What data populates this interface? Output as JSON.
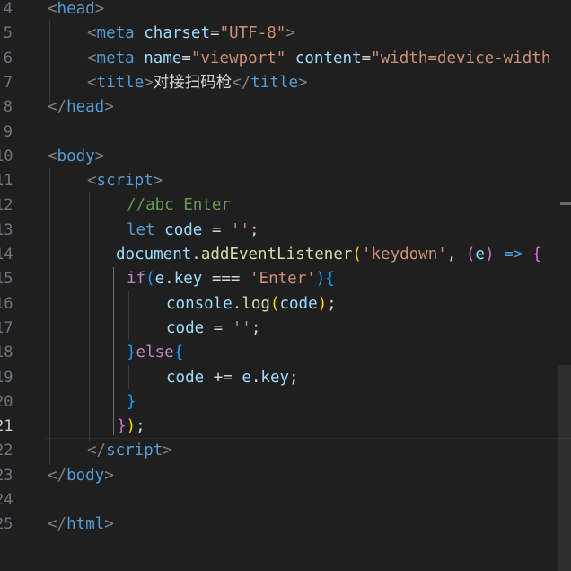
{
  "editor": {
    "language": "html",
    "active_line": "21",
    "colors": {
      "background": "#1f1f1f",
      "tag": "#569cd6",
      "attribute": "#9cdcfe",
      "string": "#ce9178",
      "comment": "#6a9955",
      "function": "#dcdcaa",
      "control_keyword": "#c586c0",
      "bracket_level1": "#ffd700",
      "bracket_level2": "#da70d6",
      "bracket_level3": "#179fff"
    },
    "lines": [
      {
        "number": "4",
        "tokens": [
          [
            "t-br",
            "<"
          ],
          [
            "t-tag",
            "head"
          ],
          [
            "t-br",
            ">"
          ]
        ]
      },
      {
        "number": "5",
        "tokens": [
          [
            "t-br",
            "<"
          ],
          [
            "t-tag",
            "meta"
          ],
          [
            "t-text",
            " "
          ],
          [
            "t-attr",
            "charset"
          ],
          [
            "t-text",
            "="
          ],
          [
            "t-str",
            "\"UTF-8\""
          ],
          [
            "t-br",
            ">"
          ]
        ]
      },
      {
        "number": "6",
        "tokens": [
          [
            "t-br",
            "<"
          ],
          [
            "t-tag",
            "meta"
          ],
          [
            "t-text",
            " "
          ],
          [
            "t-attr",
            "name"
          ],
          [
            "t-text",
            "="
          ],
          [
            "t-str",
            "\"viewport\""
          ],
          [
            "t-text",
            " "
          ],
          [
            "t-attr",
            "content"
          ],
          [
            "t-text",
            "="
          ],
          [
            "t-str",
            "\"width=device-width"
          ]
        ]
      },
      {
        "number": "7",
        "tokens": [
          [
            "t-br",
            "<"
          ],
          [
            "t-tag",
            "title"
          ],
          [
            "t-br",
            ">"
          ],
          [
            "t-text",
            "对接扫码枪"
          ],
          [
            "t-br",
            "</"
          ],
          [
            "t-tag",
            "title"
          ],
          [
            "t-br",
            ">"
          ]
        ]
      },
      {
        "number": "8",
        "tokens": [
          [
            "t-br",
            "</"
          ],
          [
            "t-tag",
            "head"
          ],
          [
            "t-br",
            ">"
          ]
        ]
      },
      {
        "number": "9",
        "tokens": []
      },
      {
        "number": "10",
        "tokens": [
          [
            "t-br",
            "<"
          ],
          [
            "t-tag",
            "body"
          ],
          [
            "t-br",
            ">"
          ]
        ]
      },
      {
        "number": "11",
        "tokens": [
          [
            "t-br",
            "<"
          ],
          [
            "t-tag",
            "script"
          ],
          [
            "t-br",
            ">"
          ]
        ]
      },
      {
        "number": "12",
        "tokens": [
          [
            "t-cm",
            "//abc Enter"
          ]
        ]
      },
      {
        "number": "13",
        "tokens": [
          [
            "t-kw",
            "let"
          ],
          [
            "t-text",
            " "
          ],
          [
            "t-var",
            "code"
          ],
          [
            "t-op",
            " = "
          ],
          [
            "t-str",
            "''"
          ],
          [
            "t-text",
            ";"
          ]
        ]
      },
      {
        "number": "14",
        "tokens": [
          [
            "t-var",
            "document"
          ],
          [
            "t-text",
            "."
          ],
          [
            "t-fn",
            "addEventListener"
          ],
          [
            "t-p1",
            "("
          ],
          [
            "t-str",
            "'keydown'"
          ],
          [
            "t-text",
            ", "
          ],
          [
            "t-p2",
            "("
          ],
          [
            "t-var",
            "e"
          ],
          [
            "t-p2",
            ")"
          ],
          [
            "t-text",
            " "
          ],
          [
            "t-kw",
            "=>"
          ],
          [
            "t-text",
            " "
          ],
          [
            "t-p2",
            "{"
          ]
        ]
      },
      {
        "number": "15",
        "tokens": [
          [
            "t-ctrl",
            "if"
          ],
          [
            "t-p3",
            "("
          ],
          [
            "t-var",
            "e"
          ],
          [
            "t-text",
            "."
          ],
          [
            "t-var",
            "key"
          ],
          [
            "t-op",
            " === "
          ],
          [
            "t-str",
            "'Enter'"
          ],
          [
            "t-p3",
            ")"
          ],
          [
            "t-p3",
            "{"
          ]
        ]
      },
      {
        "number": "16",
        "tokens": [
          [
            "t-var",
            "console"
          ],
          [
            "t-text",
            "."
          ],
          [
            "t-fn",
            "log"
          ],
          [
            "t-p1",
            "("
          ],
          [
            "t-var",
            "code"
          ],
          [
            "t-p1",
            ")"
          ],
          [
            "t-text",
            ";"
          ]
        ]
      },
      {
        "number": "17",
        "tokens": [
          [
            "t-var",
            "code"
          ],
          [
            "t-op",
            " = "
          ],
          [
            "t-str",
            "''"
          ],
          [
            "t-text",
            ";"
          ]
        ]
      },
      {
        "number": "18",
        "tokens": [
          [
            "t-p3",
            "}"
          ],
          [
            "t-ctrl",
            "else"
          ],
          [
            "t-p3",
            "{"
          ]
        ]
      },
      {
        "number": "19",
        "tokens": [
          [
            "t-var",
            "code"
          ],
          [
            "t-op",
            " += "
          ],
          [
            "t-var",
            "e"
          ],
          [
            "t-text",
            "."
          ],
          [
            "t-var",
            "key"
          ],
          [
            "t-text",
            ";"
          ]
        ]
      },
      {
        "number": "20",
        "tokens": [
          [
            "t-p3",
            "}"
          ]
        ]
      },
      {
        "number": "21",
        "tokens": [
          [
            "t-p2",
            "}"
          ],
          [
            "t-p1",
            ")"
          ],
          [
            "t-text",
            ";"
          ]
        ]
      },
      {
        "number": "22",
        "tokens": [
          [
            "t-br",
            "</"
          ],
          [
            "t-tag",
            "script"
          ],
          [
            "t-br",
            ">"
          ]
        ]
      },
      {
        "number": "23",
        "tokens": [
          [
            "t-br",
            "</"
          ],
          [
            "t-tag",
            "body"
          ],
          [
            "t-br",
            ">"
          ]
        ]
      },
      {
        "number": "24",
        "tokens": []
      },
      {
        "number": "25",
        "tokens": [
          [
            "t-br",
            "</"
          ],
          [
            "t-tag",
            "html"
          ],
          [
            "t-br",
            ">"
          ]
        ]
      }
    ]
  }
}
